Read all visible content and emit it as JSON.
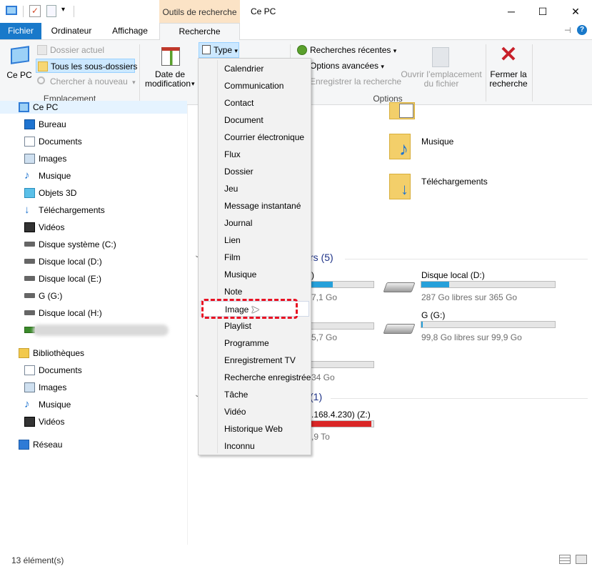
{
  "titlebar": {
    "context_tab": "Outils de recherche",
    "title": "Ce PC",
    "minimize": "─",
    "maximize": "☐",
    "close": "✕"
  },
  "tabs": [
    {
      "label": "Fichier"
    },
    {
      "label": "Ordinateur"
    },
    {
      "label": "Affichage"
    },
    {
      "label": "Recherche"
    }
  ],
  "ribbon": {
    "location": {
      "ce_pc": "Ce PC",
      "dossier_actuel": "Dossier actuel",
      "tous_sous_dossiers": "Tous les sous-dossiers",
      "chercher_nouveau": "Chercher à nouveau",
      "group_label": "Emplacement"
    },
    "refine": {
      "date_modif_l1": "Date de",
      "date_modif_l2": "modification",
      "type": "Type"
    },
    "options": {
      "recherches_recentes": "Recherches récentes",
      "options_avancees": "Options avancées",
      "enregistrer": "Enregistrer la recherche",
      "ouvrir_l1": "Ouvrir l’emplacement",
      "ouvrir_l2": "du fichier",
      "fermer_l1": "Fermer la",
      "fermer_l2": "recherche",
      "group_label": "Options"
    }
  },
  "type_menu": {
    "items": [
      "Calendrier",
      "Communication",
      "Contact",
      "Document",
      "Courrier électronique",
      "Flux",
      "Dossier",
      "Jeu",
      "Message instantané",
      "Journal",
      "Lien",
      "Film",
      "Musique",
      "Note",
      "Image",
      "Playlist",
      "Programme",
      "Enregistrement TV",
      "Recherche enregistrée",
      "Tâche",
      "Vidéo",
      "Historique Web",
      "Inconnu"
    ],
    "highlighted": "Image"
  },
  "nav": {
    "ce_pc": "Ce PC",
    "items": [
      "Bureau",
      "Documents",
      "Images",
      "Musique",
      "Objets 3D",
      "Téléchargements",
      "Vidéos",
      "Disque système (C:)",
      "Disque local (D:)",
      "Disque local (E:)",
      "G (G:)",
      "Disque local (H:)"
    ],
    "bibliotheques": "Bibliothèques",
    "lib_items": [
      "Documents",
      "Images",
      "Musique",
      "Vidéos"
    ],
    "reseau": "Réseau"
  },
  "content": {
    "folders": [
      {
        "name": "Musique"
      },
      {
        "name": "Téléchargements"
      }
    ],
    "section_drives": "rs (5)",
    "section_network": "(1)",
    "drives": [
      {
        "name": ")",
        "free": "7,1 Go",
        "fill": 0.35,
        "color": "#26a0da"
      },
      {
        "name": "Disque local (D:)",
        "free": "287 Go libres sur 365 Go",
        "fill": 0.21,
        "color": "#26a0da"
      },
      {
        "name": "",
        "free": "5,7 Go",
        "fill": 0.0,
        "color": "#26a0da"
      },
      {
        "name": "G (G:)",
        "free": "99,8 Go libres sur 99,9 Go",
        "fill": 0.01,
        "color": "#26a0da"
      },
      {
        "name": "",
        "free": "34 Go",
        "fill": 0.0,
        "color": "#26a0da"
      },
      {
        "name": ".168.4.230) (Z:)",
        "free": ",9 To",
        "fill": 0.97,
        "color": "#da2626"
      }
    ]
  },
  "status": {
    "count": "13 élément(s)"
  },
  "colors": {
    "accent": "#1979ca",
    "context_tab_bg": "#fbe3c6",
    "selection": "#cce8ff",
    "highlight_box": "#e81123"
  }
}
